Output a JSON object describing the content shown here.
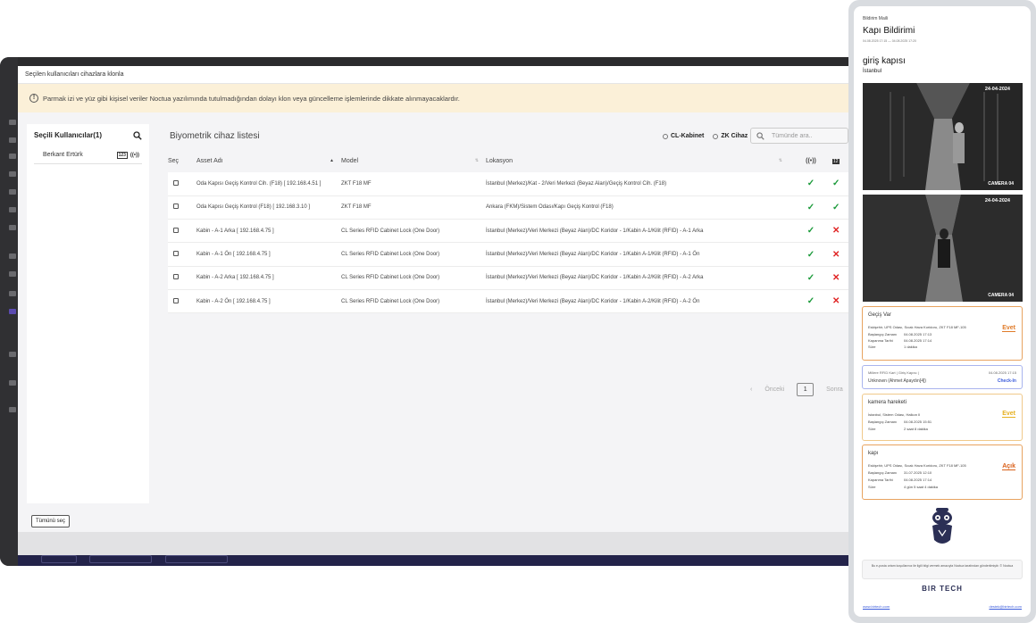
{
  "modal": {
    "title": "Seçilen kullanıcıları cihazlara klonla",
    "warning": "Parmak izi ve yüz gibi kişisel veriler Noctua yazılımında tutulmadığından dolayı klon veya güncelleme işlemlerinde dikkate alınmayacaklardır.",
    "select_all": "Tümünü seç"
  },
  "users_panel": {
    "title": "Seçili Kullanıcılar(1)",
    "users": [
      {
        "name": "Berkant Ertürk",
        "id_badge": "123",
        "rfid_badge": "((•))"
      }
    ]
  },
  "device_list": {
    "title": "Biyometrik cihaz listesi",
    "radio_options": [
      "CL-Kabinet",
      "ZK Cihaz"
    ],
    "search_placeholder": "Tümünde ara..",
    "columns": {
      "select": "Seç",
      "asset": "Asset Adı",
      "model": "Model",
      "location": "Lokasyon",
      "rfid_icon": "((•))",
      "id_icon": "12"
    },
    "rows": [
      {
        "asset": "Oda Kapısı Geçiş Kontrol Cih. (F18) [ 192.168.4.51 ]",
        "model": "ZKT F18 MF",
        "location": "İstanbul (Merkez)/Kat - 2/Veri Merkezi (Beyaz Alan)/Geçiş Kontrol Cih. (F18)",
        "rfid": "✓",
        "id": "✓"
      },
      {
        "asset": "Oda Kapısı Geçiş Kontrol (F18) [ 192.168.3.10 ]",
        "model": "ZKT F18 MF",
        "location": "Ankara (FKM)/Sistem Odası/Kapı Geçiş Kontrol (F18)",
        "rfid": "✓",
        "id": "✓"
      },
      {
        "asset": "Kabin - A-1 Arka [ 192.168.4.75 ]",
        "model": "CL Series RFID Cabinet Lock (One Door)",
        "location": "İstanbul (Merkez)/Veri Merkezi (Beyaz Alan)/DC Koridor - 1/Kabin A-1/Kilit (RFID) - A-1 Arka",
        "rfid": "✓",
        "id": "✕"
      },
      {
        "asset": "Kabin - A-1 Ön [ 192.168.4.75 ]",
        "model": "CL Series RFID Cabinet Lock (One Door)",
        "location": "İstanbul (Merkez)/Veri Merkezi (Beyaz Alan)/DC Koridor - 1/Kabin A-1/Kilit (RFID) - A-1 Ön",
        "rfid": "✓",
        "id": "✕"
      },
      {
        "asset": "Kabin - A-2 Arka [ 192.168.4.75 ]",
        "model": "CL Series RFID Cabinet Lock (One Door)",
        "location": "İstanbul (Merkez)/Veri Merkezi (Beyaz Alan)/DC Koridor - 1/Kabin A-2/Kilit (RFID) - A-2 Arka",
        "rfid": "✓",
        "id": "✕"
      },
      {
        "asset": "Kabin - A-2 Ön [ 192.168.4.75 ]",
        "model": "CL Series RFID Cabinet Lock (One Door)",
        "location": "İstanbul (Merkez)/Veri Merkezi (Beyaz Alan)/DC Koridor - 1/Kabin A-2/Kilit (RFID) - A-2 Ön",
        "rfid": "✓",
        "id": "✕"
      }
    ],
    "pager": {
      "prev_arrow": "‹",
      "prev": "Önceki",
      "page": "1",
      "next": "Sonra"
    }
  },
  "email": {
    "kicker": "Bildirim Maili",
    "title": "Kapı Bildirimi",
    "range": "04.08.2025 17:15 — 04.08.2025 17:20",
    "door": "giriş kapısı",
    "city": "İstanbul",
    "cameras": [
      {
        "date": "24-04-2024",
        "label": "CAMERA 04"
      },
      {
        "date": "24-04-2024",
        "label": "CAMERA 04"
      }
    ],
    "cards": [
      {
        "title": "Geçiş Var",
        "line1": "Eskişehir, UPS Odası, Sıcak Hava Koridoru, ZKT F18 MF-105",
        "k1": "Başlangıç Zamanı",
        "v1": "04.08.2025 17:13",
        "k2": "Kapanma Tarihi",
        "v2": "04.08.2025 17:14",
        "k3": "Süre",
        "v3": "1 dakika",
        "status": "Evet"
      },
      {
        "header": "Millere RFID Kart | Giriş Kapısı |",
        "time": "04.08.2025 17:15",
        "person": "Unknown (Ahmet Apaydın[4])",
        "status": "Check-In"
      },
      {
        "title": "kamera hareketi",
        "line1": "İstanbul, Sistem Odası, Halkon II",
        "k1": "Başlangıç Zamanı",
        "v1": "04.08.2025 15:51",
        "k2": "Süre",
        "v2": "2 saat 8 dakika",
        "status": "Evet"
      },
      {
        "title": "kapı",
        "line1": "Eskişehir, UPS Odası, Sıcak Hava Koridoru, ZKT F18 MF-105",
        "k1": "Başlangıç Zamanı",
        "v1": "31.07.2025 12:10",
        "k2": "Kapanma Tarihi",
        "v2": "04.08.2025 17:14",
        "k3": "Süre",
        "v3": "4 gün 5 saat 4 dakika",
        "status": "Açık"
      }
    ],
    "footer_note": "Bu e-posta ortam koşullarınız ile ilgili bilgi vermek amacıyla Noctua tarafından gönderilmiştir. © Noctua",
    "brand": "BIR TECH",
    "link_left": "www.birtech.com",
    "link_right": "destek@birtech.com"
  },
  "colors": {
    "accent_orange": "#e07b2a",
    "ok_green": "#1b9a3a",
    "error_red": "#e02424",
    "checkin_blue": "#3b5bdb",
    "warn_bg": "#fbf0d8"
  }
}
